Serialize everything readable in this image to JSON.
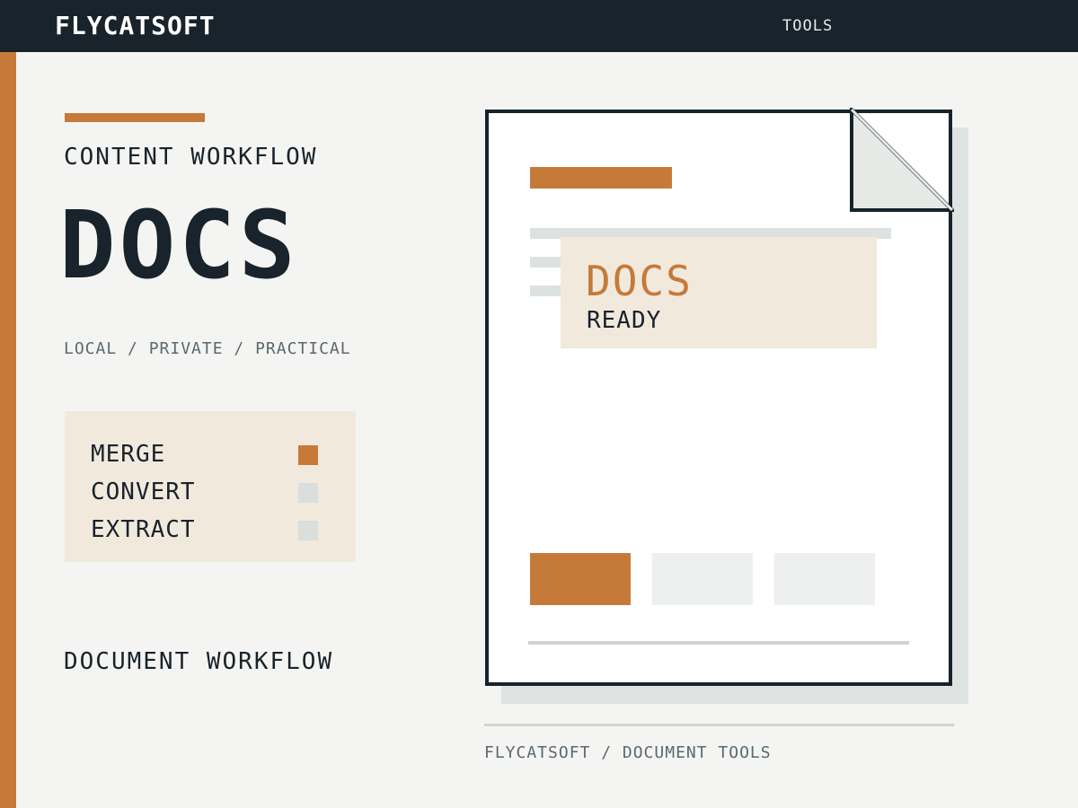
{
  "header": {
    "brand": "FLYCATSOFT",
    "nav_tools": "TOOLS"
  },
  "hero": {
    "eyebrow": "CONTENT WORKFLOW",
    "title": "DOCS",
    "tagline": "LOCAL / PRIVATE / PRACTICAL"
  },
  "operations": [
    {
      "label": "MERGE",
      "active": true
    },
    {
      "label": "CONVERT",
      "active": false
    },
    {
      "label": "EXTRACT",
      "active": false
    }
  ],
  "footer_heading": "DOCUMENT WORKFLOW",
  "document": {
    "badge_title": "DOCS",
    "badge_status": "READY"
  },
  "caption": "FLYCATSOFT / DOCUMENT TOOLS",
  "colors": {
    "accent": "#c67a3a",
    "dark": "#18232b",
    "cream": "#f2e9dd",
    "inactive": "#d9dfdc",
    "background": "#f4f5f2"
  }
}
